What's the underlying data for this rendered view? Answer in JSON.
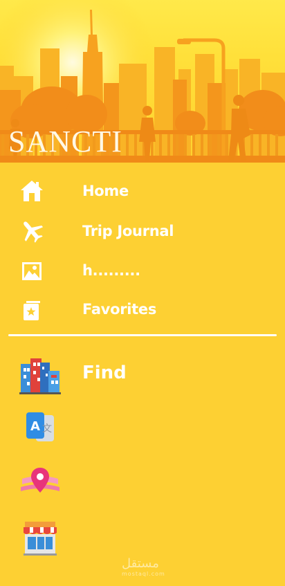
{
  "header": {
    "brand": "SANCTI"
  },
  "menu": {
    "items": [
      {
        "label": "Home",
        "icon": "home-icon"
      },
      {
        "label": "Trip Journal",
        "icon": "airplane-icon"
      },
      {
        "label": "h.........",
        "icon": "image-icon"
      },
      {
        "label": "Favorites",
        "icon": "star-card-icon"
      }
    ]
  },
  "features": {
    "items": [
      {
        "label": "Find",
        "icon": "city-buildings-icon"
      },
      {
        "label": "",
        "icon": "translate-icon"
      },
      {
        "label": "",
        "icon": "map-pin-icon"
      },
      {
        "label": "",
        "icon": "shop-icon"
      }
    ]
  },
  "watermark": {
    "text": "مستقل",
    "subtext": "mostaql.com"
  },
  "colors": {
    "background": "#fdd033",
    "skyline": "#f7a21f",
    "text": "#ffffff"
  }
}
